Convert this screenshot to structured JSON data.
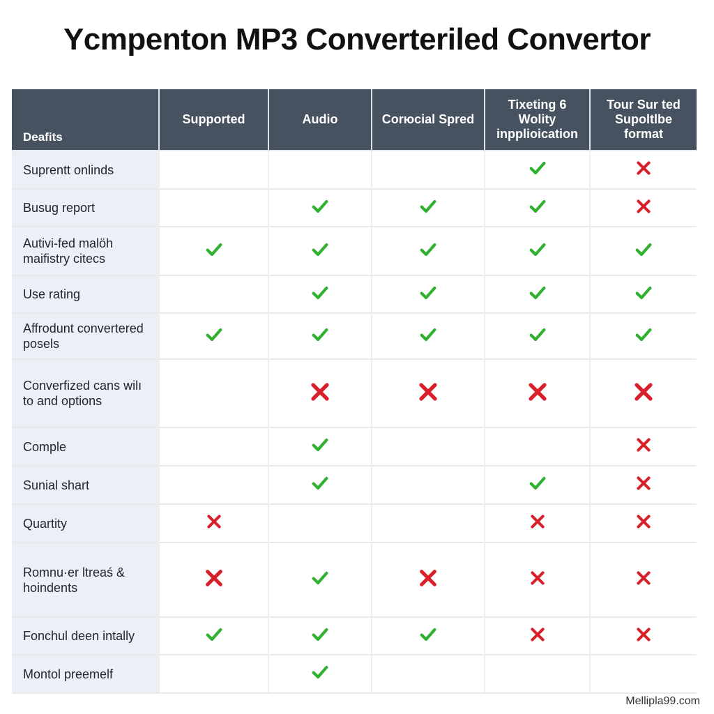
{
  "title": "Ycmpenton MP3 Converteriled Convertor",
  "colors": {
    "header_bg": "#46525f",
    "feature_bg": "#eaf0f5",
    "check": "#2fb12f",
    "cross": "#d9202a"
  },
  "table": {
    "columns": [
      "Deafits",
      "Supported",
      "Audio",
      "Corюcial Spred",
      "Tixeting 6 Wolity inpplioication",
      "Tour Sur ted Supoltlbe format"
    ],
    "rows": [
      {
        "feature": "Suprentt onlinds",
        "cells": [
          "",
          "",
          "",
          "check",
          "cross"
        ]
      },
      {
        "feature": "Busug report",
        "cells": [
          "",
          "check",
          "check",
          "check",
          "cross"
        ]
      },
      {
        "feature": "Autivi-fed malöh maifistry citecs",
        "cells": [
          "check",
          "check",
          "check",
          "check",
          "check"
        ]
      },
      {
        "feature": "Use rating",
        "cells": [
          "",
          "check",
          "check",
          "check",
          "check"
        ]
      },
      {
        "feature": "Affrodunt convertered posels",
        "cells": [
          "check",
          "check",
          "check",
          "check",
          "check"
        ]
      },
      {
        "feature": "Converfized cans wilı to and options",
        "cells": [
          "",
          "cross",
          "cross",
          "cross",
          "cross"
        ]
      },
      {
        "feature": "Comple",
        "cells": [
          "",
          "check",
          "",
          "",
          "cross"
        ]
      },
      {
        "feature": "Sunial shart",
        "cells": [
          "",
          "check",
          "",
          "check",
          "cross"
        ]
      },
      {
        "feature": "Quartity",
        "cells": [
          "cross",
          "",
          "",
          "cross",
          "cross"
        ]
      },
      {
        "feature": "Romnu·er ltreaś & hoindents",
        "cells": [
          "cross",
          "check",
          "cross",
          "cross",
          "cross"
        ]
      },
      {
        "feature": "Fonchul deen intally",
        "cells": [
          "check",
          "check",
          "check",
          "cross",
          "cross"
        ]
      },
      {
        "feature": "Montol preemelf",
        "cells": [
          "",
          "check",
          "",
          "",
          ""
        ]
      }
    ]
  },
  "watermark": "Mellipla99.com"
}
